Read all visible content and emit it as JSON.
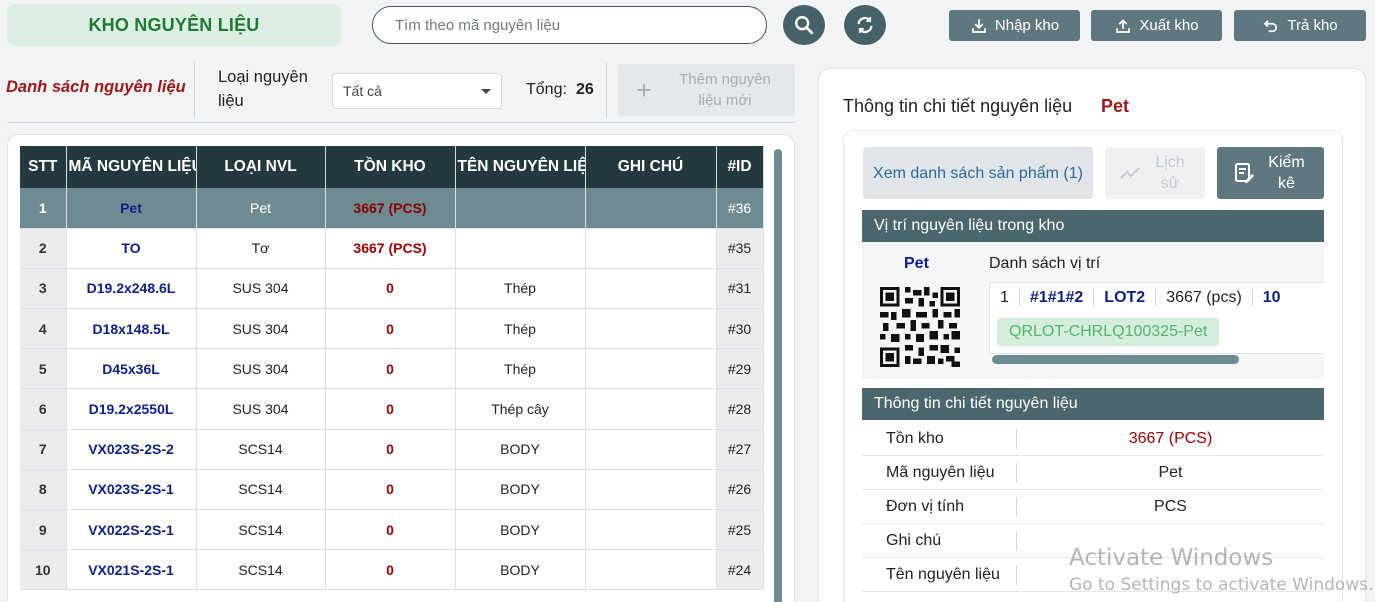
{
  "header": {
    "brand": "KHO NGUYÊN LIỆU",
    "search_placeholder": "Tìm theo mã nguyên liệu",
    "import_label": "Nhập kho",
    "export_label": "Xuất kho",
    "return_label": "Trả kho"
  },
  "filter": {
    "list_title": "Danh sách nguyên liệu",
    "type_label": "Loại nguyên liệu",
    "type_selected": "Tất cả",
    "total_label": "Tổng:",
    "total_value": "26",
    "add_label": "Thêm nguyên liệu mới"
  },
  "table": {
    "columns": [
      "STT",
      "MÃ NGUYÊN LIỆU",
      "LOẠI NVL",
      "TỒN KHO",
      "TÊN NGUYÊN LIỆU",
      "GHI CHÚ",
      "#ID"
    ],
    "rows": [
      {
        "stt": "1",
        "code": "Pet",
        "type": "Pet",
        "stock": "3667 (PCS)",
        "name": "",
        "note": "",
        "id": "#36",
        "selected": true
      },
      {
        "stt": "2",
        "code": "TO",
        "type": "Tơ",
        "stock": "3667 (PCS)",
        "name": "",
        "note": "",
        "id": "#35"
      },
      {
        "stt": "3",
        "code": "D19.2x248.6L",
        "type": "SUS 304",
        "stock": "0",
        "name": "Thép",
        "note": "",
        "id": "#31"
      },
      {
        "stt": "4",
        "code": "D18x148.5L",
        "type": "SUS 304",
        "stock": "0",
        "name": "Thép",
        "note": "",
        "id": "#30"
      },
      {
        "stt": "5",
        "code": "D45x36L",
        "type": "SUS 304",
        "stock": "0",
        "name": "Thép",
        "note": "",
        "id": "#29"
      },
      {
        "stt": "6",
        "code": "D19.2x2550L",
        "type": "SUS 304",
        "stock": "0",
        "name": "Thép cây",
        "note": "",
        "id": "#28"
      },
      {
        "stt": "7",
        "code": "VX023S-2S-2",
        "type": "SCS14",
        "stock": "0",
        "name": "BODY",
        "note": "",
        "id": "#27"
      },
      {
        "stt": "8",
        "code": "VX023S-2S-1",
        "type": "SCS14",
        "stock": "0",
        "name": "BODY",
        "note": "",
        "id": "#26"
      },
      {
        "stt": "9",
        "code": "VX022S-2S-1",
        "type": "SCS14",
        "stock": "0",
        "name": "BODY",
        "note": "",
        "id": "#25"
      },
      {
        "stt": "10",
        "code": "VX021S-2S-1",
        "type": "SCS14",
        "stock": "0",
        "name": "BODY",
        "note": "",
        "id": "#24"
      }
    ]
  },
  "detail": {
    "title": "Thông tin chi tiết nguyên liệu",
    "name": "Pet",
    "view_products_label": "Xem danh sách sản phẩm (1)",
    "history_label": "Lịch sử",
    "inventory_check_label": "Kiểm kê",
    "location_section": "Vị trí nguyên liệu trong kho",
    "location_item_name": "Pet",
    "location_list_title": "Danh sách vị trí",
    "location_row": {
      "index": "1",
      "position": "#1#1#2",
      "lot": "LOT2",
      "qty": "3667 (pcs)",
      "extra": "10"
    },
    "qr_code": "QRLOT-CHRLQ100325-Pet",
    "info_section": "Thông tin chi tiết nguyên liệu",
    "info": [
      {
        "key": "Tồn kho",
        "value": "3667 (PCS)",
        "red": true
      },
      {
        "key": "Mã nguyên liệu",
        "value": "Pet"
      },
      {
        "key": "Đơn vị tính",
        "value": "PCS"
      },
      {
        "key": "Ghi chú",
        "value": ""
      },
      {
        "key": "Tên nguyên liệu",
        "value": ""
      }
    ]
  },
  "watermark": {
    "line1": "Activate Windows",
    "line2": "Go to Settings to activate Windows."
  },
  "colors": {
    "brand_green": "#1f7a33",
    "dark_teal": "#23393f",
    "accent_red": "#a01818",
    "code_blue": "#0d1f8a"
  }
}
